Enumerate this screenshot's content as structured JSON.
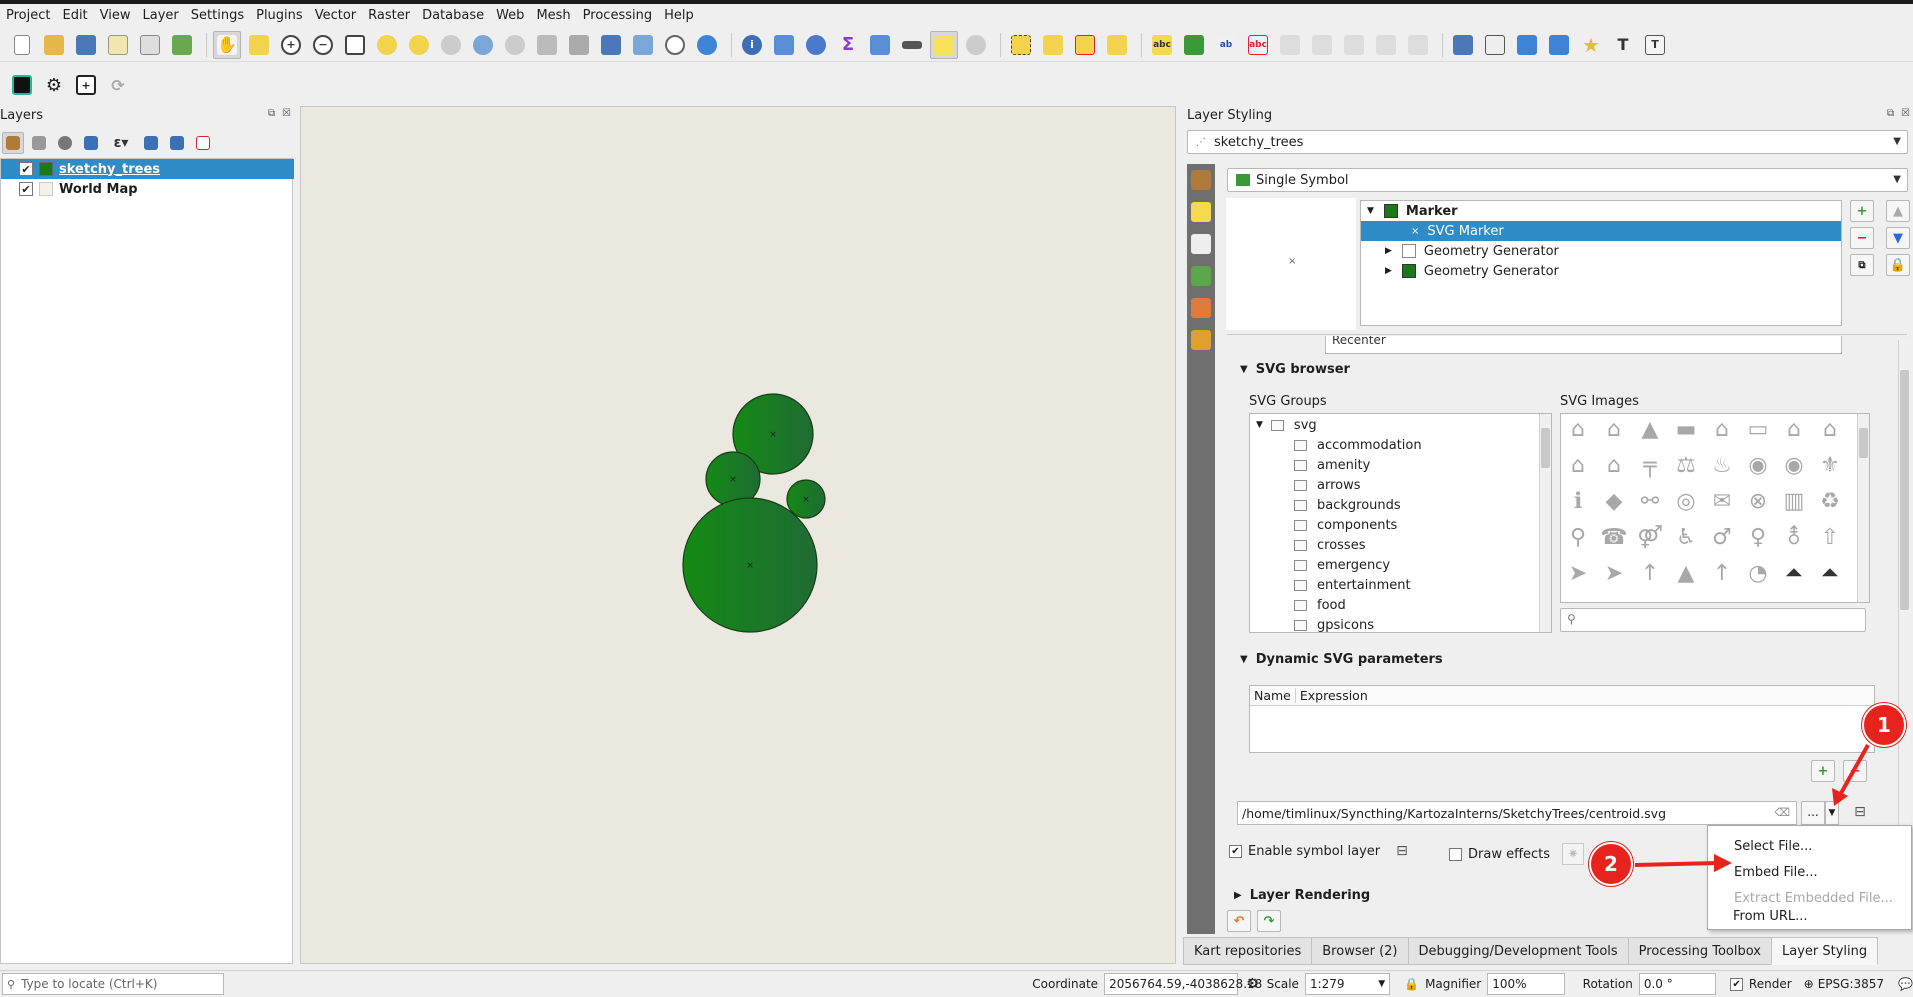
{
  "menubar": {
    "items": [
      "Project",
      "Edit",
      "View",
      "Layer",
      "Settings",
      "Plugins",
      "Vector",
      "Raster",
      "Database",
      "Web",
      "Mesh",
      "Processing",
      "Help"
    ]
  },
  "layers_panel": {
    "title": "Layers",
    "layers": [
      {
        "name": "sketchy_trees",
        "checked": true,
        "selected": true
      },
      {
        "name": "World Map",
        "checked": true,
        "selected": false
      }
    ]
  },
  "styling": {
    "title": "Layer Styling",
    "layer_combo": "sketchy_trees",
    "renderer_combo": "Single Symbol",
    "symbol_tree": {
      "root": "Marker",
      "items": [
        "SVG Marker",
        "Geometry Generator",
        "Geometry Generator"
      ]
    },
    "partial_field": "Recenter",
    "svg_browser": {
      "header": "SVG browser",
      "groups_label": "SVG Groups",
      "images_label": "SVG Images",
      "root": "svg",
      "groups": [
        "accommodation",
        "amenity",
        "arrows",
        "backgrounds",
        "components",
        "crosses",
        "emergency",
        "entertainment",
        "food",
        "gpsicons"
      ]
    },
    "dynamic": {
      "header": "Dynamic SVG parameters",
      "col_name": "Name",
      "col_expression": "Expression"
    },
    "path": "/home/timlinux/Syncthing/KartozaInterns/SketchyTrees/centroid.svg",
    "browse_label": "...",
    "enable_symbol_layer": "Enable symbol layer",
    "draw_effects": "Draw effects",
    "layer_rendering": "Layer Rendering"
  },
  "dropdown": {
    "items": [
      {
        "label": "Select File...",
        "enabled": true
      },
      {
        "label": "Embed File...",
        "enabled": true
      },
      {
        "label": "Extract Embedded File...",
        "enabled": false
      },
      {
        "label": "From URL...",
        "enabled": true
      }
    ]
  },
  "annotations": {
    "badge1": "1",
    "badge2": "2",
    "color": "#e8221d"
  },
  "bottom_tabs": [
    "Kart repositories",
    "Browser (2)",
    "Debugging/Development Tools",
    "Processing Toolbox",
    "Layer Styling"
  ],
  "statusbar": {
    "locate_placeholder": "Type to locate (Ctrl+K)",
    "coordinate_label": "Coordinate",
    "coordinate_value": "2056764.59,-4038628.18",
    "scale_label": "Scale",
    "scale_value": "1:279",
    "magnifier_label": "Magnifier",
    "magnifier_value": "100%",
    "rotation_label": "Rotation",
    "rotation_value": "0.0 °",
    "render_label": "Render",
    "crs": "EPSG:3857"
  },
  "colors": {
    "selection": "#308cc6",
    "tree_green": "#1a7a1a",
    "canvas": "#ebe8e0"
  }
}
